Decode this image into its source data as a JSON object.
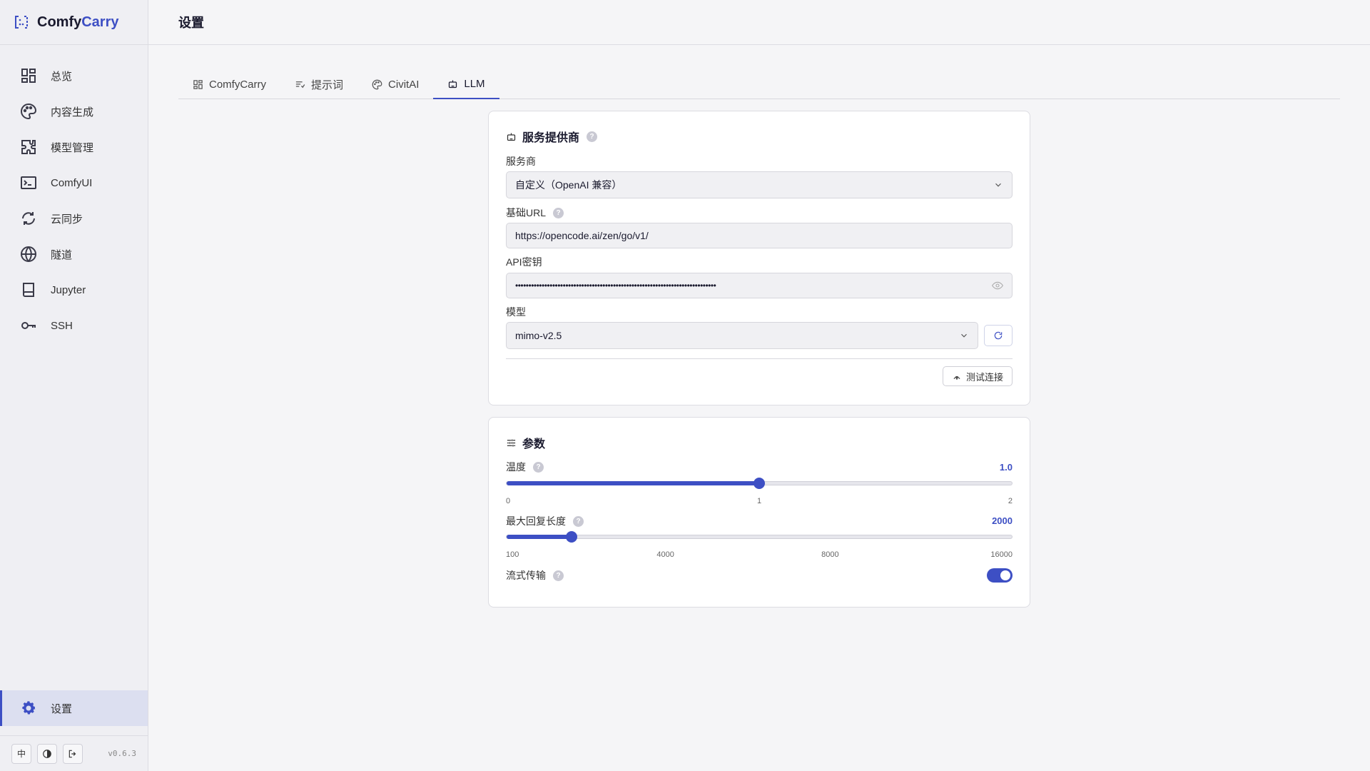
{
  "brand": {
    "name_part1": "Comfy",
    "name_part2": "Carry"
  },
  "sidebar": {
    "items": [
      {
        "label": "总览",
        "icon": "dashboard-icon"
      },
      {
        "label": "内容生成",
        "icon": "palette-icon"
      },
      {
        "label": "模型管理",
        "icon": "puzzle-icon"
      },
      {
        "label": "ComfyUI",
        "icon": "terminal-icon"
      },
      {
        "label": "云同步",
        "icon": "sync-icon"
      },
      {
        "label": "隧道",
        "icon": "globe-icon"
      },
      {
        "label": "Jupyter",
        "icon": "book-icon"
      },
      {
        "label": "SSH",
        "icon": "key-icon"
      }
    ],
    "settings_label": "设置",
    "footer": {
      "lang": "中",
      "version": "v0.6.3"
    }
  },
  "header": {
    "title": "设置"
  },
  "tabs": [
    {
      "label": "ComfyCarry",
      "icon": "grid-icon"
    },
    {
      "label": "提示词",
      "icon": "prompt-icon"
    },
    {
      "label": "CivitAI",
      "icon": "palette-icon"
    },
    {
      "label": "LLM",
      "icon": "robot-icon",
      "active": true
    }
  ],
  "provider_card": {
    "title": "服务提供商",
    "service_label": "服务商",
    "service_value": "自定义（OpenAI 兼容）",
    "base_url_label": "基础URL",
    "base_url_value": "https://opencode.ai/zen/go/v1/",
    "api_key_label": "API密钥",
    "api_key_value": "••••••••••••••••••••••••••••••••••••••••••••••••••••••••••••••••••••••••••••",
    "model_label": "模型",
    "model_value": "mimo-v2.5",
    "test_button": "测试连接"
  },
  "params_card": {
    "title": "参数",
    "temperature": {
      "label": "温度",
      "value": "1.0",
      "level": 0.5,
      "ticks": [
        "0",
        "1",
        "2"
      ]
    },
    "max_tokens": {
      "label": "最大回复长度",
      "value": "2000",
      "level": 0.128,
      "ticks": [
        "100",
        "4000",
        "8000",
        "16000"
      ]
    },
    "stream": {
      "label": "流式传输",
      "enabled": true
    }
  },
  "colors": {
    "accent": "#3d4fc4"
  },
  "help_glyph": "?"
}
